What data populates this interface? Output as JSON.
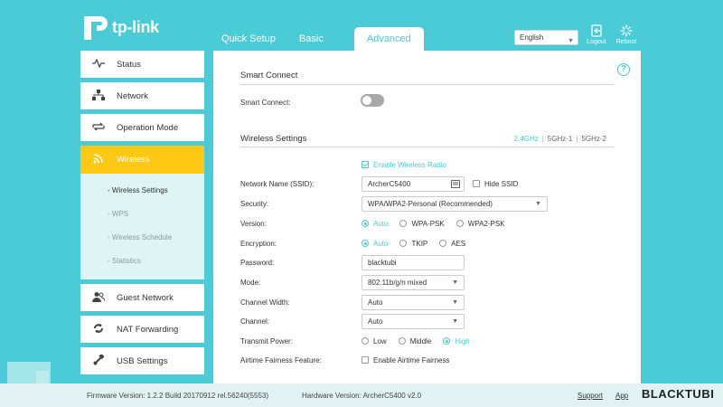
{
  "header": {
    "brand": "tp-link",
    "tabs": [
      "Quick Setup",
      "Basic",
      "Advanced"
    ],
    "active_tab": "Advanced",
    "language": "English",
    "logout_label": "Logout",
    "reboot_label": "Reboot"
  },
  "sidebar": {
    "items": [
      {
        "label": "Status",
        "icon": "pulse-icon"
      },
      {
        "label": "Network",
        "icon": "network-icon"
      },
      {
        "label": "Operation Mode",
        "icon": "operation-mode-icon"
      },
      {
        "label": "Wireless",
        "icon": "wifi-icon"
      },
      {
        "label": "Guest Network",
        "icon": "guest-icon"
      },
      {
        "label": "NAT Forwarding",
        "icon": "nat-icon"
      },
      {
        "label": "USB Settings",
        "icon": "usb-icon"
      }
    ],
    "submenu": [
      "- Wireless Settings",
      "- WPS",
      "- Wireless Schedule",
      "- Statistics"
    ]
  },
  "content": {
    "smart_connect_title": "Smart Connect",
    "smart_connect_label": "Smart Connect:",
    "wireless_settings_title": "Wireless Settings",
    "bands": [
      "2.4GHz",
      "5GHz-1",
      "5GHz-2"
    ],
    "enable_radio_label": "Enable Wireless Radio",
    "ssid_label": "Network Name (SSID):",
    "ssid_value": "ArcherC5400",
    "hide_ssid_label": "Hide SSID",
    "security_label": "Security:",
    "security_value": "WPA/WPA2-Personal (Recommended)",
    "version_label": "Version:",
    "version_options": [
      "Auto",
      "WPA-PSK",
      "WPA2-PSK"
    ],
    "encryption_label": "Encryption:",
    "encryption_options": [
      "Auto",
      "TKIP",
      "AES"
    ],
    "password_label": "Password:",
    "password_value": "blacktubi",
    "mode_label": "Mode:",
    "mode_value": "802.11b/g/n mixed",
    "channel_width_label": "Channel Width:",
    "channel_width_value": "Auto",
    "channel_label": "Channel:",
    "channel_value": "Auto",
    "transmit_power_label": "Transmit Power:",
    "transmit_power_options": [
      "Low",
      "Middle",
      "High"
    ],
    "airtime_label": "Airtime Fairness Feature:",
    "airtime_option": "Enable Airtime Fairness"
  },
  "footer": {
    "firmware": "Firmware Version: 1.2.2 Build 20170912 rel.56240(5553)",
    "hardware": "Hardware Version: ArcherC5400 v2.0",
    "support": "Support",
    "app": "App"
  },
  "watermark": "BLACKTUBI",
  "colors": {
    "accent": "#4acbd6",
    "active_nav": "#ffc813"
  }
}
